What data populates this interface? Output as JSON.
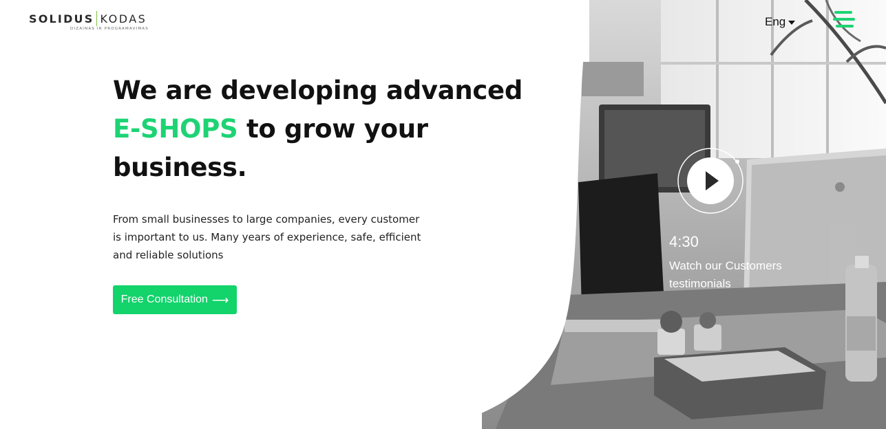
{
  "brand": {
    "name_a": "SOLIDUS",
    "name_b": "KODAS",
    "tagline": "DIZAINAS IR PROGRAMAVIMAS"
  },
  "nav": {
    "language": "Eng",
    "language_icon": "caret-down-icon",
    "menu_icon": "hamburger-menu-icon"
  },
  "hero": {
    "headline_line1": "We are developing advanced",
    "headline_accent": "E-SHOPS",
    "headline_line2": " to grow your",
    "headline_line3": "business.",
    "description": "From small businesses to large companies, every customer is important to us. Many years of experience, safe, efficient and reliable solutions",
    "cta_label": "Free Consultation",
    "cta_icon": "arrow-right-icon"
  },
  "video": {
    "play_icon": "play-icon",
    "duration": "4:30",
    "caption": "Watch our Customers testimonials"
  },
  "colors": {
    "accent": "#1ed374",
    "button": "#13d36b",
    "text": "#111111"
  }
}
